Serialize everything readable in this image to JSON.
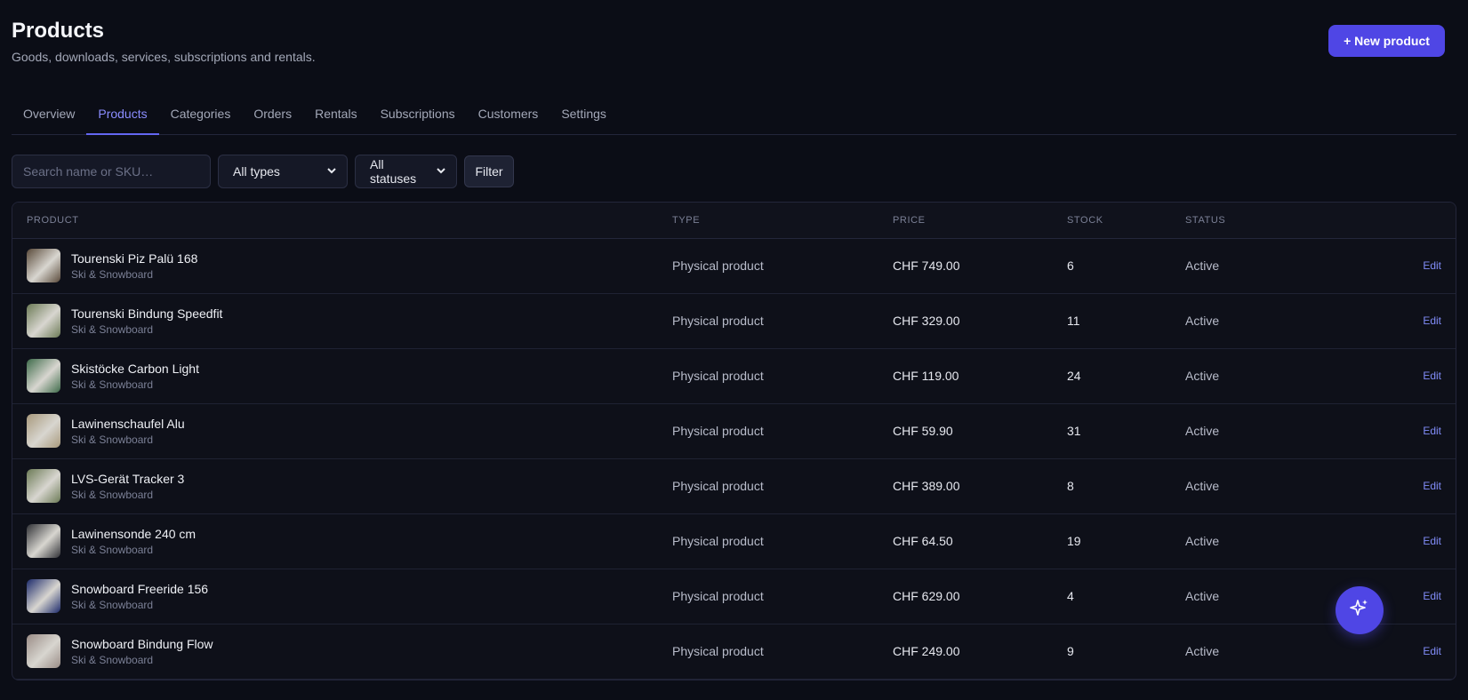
{
  "header": {
    "title": "Products",
    "subtitle": "Goods, downloads, services, subscriptions and rentals.",
    "new_button": "+ New product"
  },
  "tabs": [
    {
      "label": "Overview",
      "active": false
    },
    {
      "label": "Products",
      "active": true
    },
    {
      "label": "Categories",
      "active": false
    },
    {
      "label": "Orders",
      "active": false
    },
    {
      "label": "Rentals",
      "active": false
    },
    {
      "label": "Subscriptions",
      "active": false
    },
    {
      "label": "Customers",
      "active": false
    },
    {
      "label": "Settings",
      "active": false
    }
  ],
  "filters": {
    "search_placeholder": "Search name or SKU…",
    "type_select": "All types",
    "status_select": "All statuses",
    "filter_button": "Filter"
  },
  "table": {
    "columns": [
      "PRODUCT",
      "TYPE",
      "PRICE",
      "STOCK",
      "STATUS"
    ],
    "rows": [
      {
        "name": "Tourenski Piz Palü 168",
        "category": "Ski & Snowboard",
        "type": "Physical product",
        "price": "CHF 749.00",
        "stock": "6",
        "status": "Active",
        "action": "Edit",
        "thumb_color": "#5a4a3a"
      },
      {
        "name": "Tourenski Bindung Speedfit",
        "category": "Ski & Snowboard",
        "type": "Physical product",
        "price": "CHF 329.00",
        "stock": "11",
        "status": "Active",
        "action": "Edit",
        "thumb_color": "#6b7a55"
      },
      {
        "name": "Skistöcke Carbon Light",
        "category": "Ski & Snowboard",
        "type": "Physical product",
        "price": "CHF 119.00",
        "stock": "24",
        "status": "Active",
        "action": "Edit",
        "thumb_color": "#3e6b4a"
      },
      {
        "name": "Lawinenschaufel Alu",
        "category": "Ski & Snowboard",
        "type": "Physical product",
        "price": "CHF 59.90",
        "stock": "31",
        "status": "Active",
        "action": "Edit",
        "thumb_color": "#a8997c"
      },
      {
        "name": "LVS-Gerät Tracker 3",
        "category": "Ski & Snowboard",
        "type": "Physical product",
        "price": "CHF 389.00",
        "stock": "8",
        "status": "Active",
        "action": "Edit",
        "thumb_color": "#6b7a55"
      },
      {
        "name": "Lawinensonde 240 cm",
        "category": "Ski & Snowboard",
        "type": "Physical product",
        "price": "CHF 64.50",
        "stock": "19",
        "status": "Active",
        "action": "Edit",
        "thumb_color": "#2f3035"
      },
      {
        "name": "Snowboard Freeride 156",
        "category": "Ski & Snowboard",
        "type": "Physical product",
        "price": "CHF 629.00",
        "stock": "4",
        "status": "Active",
        "action": "Edit",
        "thumb_color": "#1c2a6b"
      },
      {
        "name": "Snowboard Bindung Flow",
        "category": "Ski & Snowboard",
        "type": "Physical product",
        "price": "CHF 249.00",
        "stock": "9",
        "status": "Active",
        "action": "Edit",
        "thumb_color": "#9a8c86"
      }
    ]
  },
  "fab": {
    "icon": "sparkles-icon"
  }
}
